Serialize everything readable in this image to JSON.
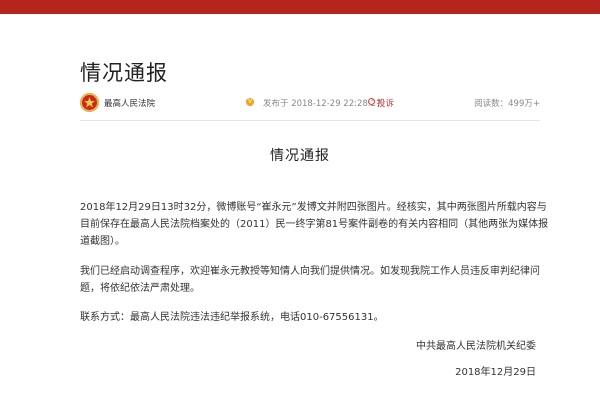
{
  "article": {
    "title": "情况通报",
    "author": "最高人民法院",
    "publish_time": "发布于 2018-12-29 22:28:27",
    "complain_label": "投诉",
    "reads": "阅读数：499万+"
  },
  "content": {
    "heading": "情况通报",
    "paragraphs": [
      "2018年12月29日13时32分，微博账号“崔永元”发博文并附四张图片。经核实，其中两张图片所载内容与目前保存在最高人民法院档案处的（2011）民一终字第81号案件副卷的有关内容相同（其他两张为媒体报道截图）。",
      "我们已经启动调查程序，欢迎崔永元教授等知情人向我们提供情况。如发现我院工作人员违反审判纪律问题，将依纪依法严肃处理。",
      "联系方式：最高人民法院违法违纪举报系统，电话010-67556131。"
    ],
    "signature": "中共最高人民法院机关纪委",
    "date": "2018年12月29日"
  },
  "colors": {
    "brand_red": "#b5251d",
    "complain_red": "#cc3333",
    "badge_orange": "#f4a020"
  },
  "icons": {
    "avatar": "court-emblem-icon",
    "verified": "verified-badge-icon",
    "complain": "complain-icon"
  }
}
